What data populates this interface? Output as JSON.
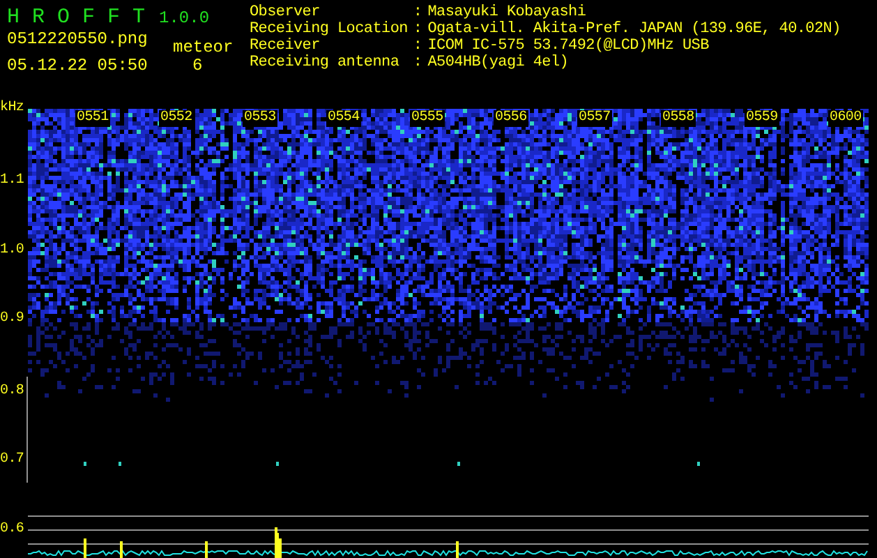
{
  "app": {
    "title": "H R O F F T",
    "version": "1.0.0"
  },
  "file": {
    "name": "0512220550.png",
    "datetime": "05.12.22 05:50"
  },
  "meteor": {
    "label": "meteor",
    "count": "6"
  },
  "station": [
    {
      "label": "Observer",
      "separator": ":",
      "value": "Masayuki Kobayashi"
    },
    {
      "label": "Receiving Location",
      "separator": ":",
      "value": "Ogata-vill. Akita-Pref. JAPAN (139.96E, 40.02N)"
    },
    {
      "label": "Receiver",
      "separator": ":",
      "value": "ICOM IC-575 53.7492(@LCD)MHz USB"
    },
    {
      "label": "Receiving antenna",
      "separator": ":",
      "value": "A504HB(yagi 4el)"
    }
  ],
  "spectrogram": {
    "frequency_unit": "kHz",
    "time_labels": [
      "0551",
      "0552",
      "0553",
      "0554",
      "0555",
      "0556",
      "0557",
      "0558",
      "0559",
      "0600"
    ],
    "frequency_labels": [
      "1.1",
      "1.0",
      "0.9",
      "0.8",
      "0.7",
      "0.6"
    ]
  }
}
